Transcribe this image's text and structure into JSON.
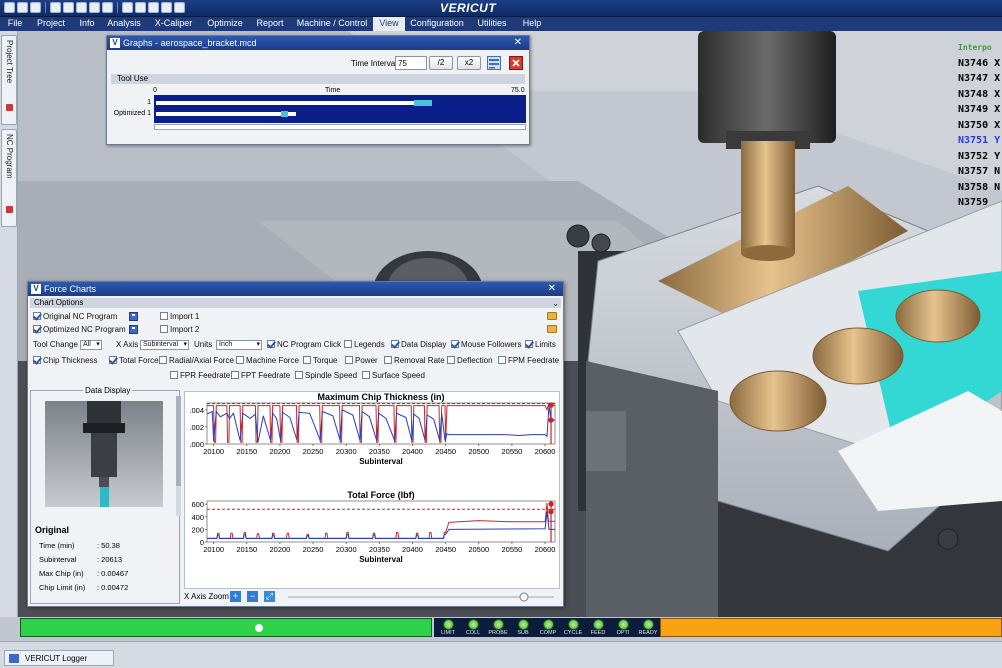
{
  "app": {
    "brand": "VERICUT"
  },
  "menu": [
    "File",
    "Project",
    "Info",
    "Analysis",
    "X-Caliper",
    "Optimize",
    "Report",
    "Machine / Control",
    "View",
    "Configuration",
    "Utilities",
    "Help"
  ],
  "active_menu": "View",
  "left_dock": {
    "tab1": "Project Tree",
    "tab2": "NC Program"
  },
  "nc_program": {
    "header": "Interpo",
    "lines": [
      "N3746 X",
      "N3747 X",
      "N3748 X",
      "N3749 X",
      "N3750 X",
      "N3751 Y",
      "N3752 Y",
      "N3757 N",
      "N3758 N",
      "N3759"
    ],
    "current_index": 5
  },
  "graphs_window": {
    "title": "Graphs - aerospace_bracket.mcd",
    "time_interval_label": "Time Interval",
    "time_interval_value": "75",
    "btn_half": "/2",
    "btn_double": "x2",
    "section": "Tool Use",
    "axis_start": "0",
    "axis_label": "Time",
    "axis_end": "75.0",
    "rows": [
      {
        "label": "1",
        "fill": 0.74,
        "marker_start": 0.7,
        "marker_width": 0.05
      },
      {
        "label": "Optimized 1",
        "fill": 0.38,
        "marker_start": 0.34,
        "marker_width": 0.02
      }
    ]
  },
  "force_window": {
    "title": "Force Charts",
    "chart_options_label": "Chart Options",
    "row1": {
      "original": "Original NC Program",
      "optimized": "Optimized NC Program",
      "import1": "Import 1",
      "import2": "Import 2"
    },
    "row3": {
      "tool_change_label": "Tool Change",
      "tool_change_value": "All",
      "x_axis_label": "X Axis",
      "x_axis_value": "Subinterval",
      "units_label": "Units",
      "units_value": "Inch",
      "nc_program_click": "NC Program Click",
      "legends": "Legends",
      "data_display": "Data Display",
      "mouse_followers": "Mouse Followers",
      "limits": "Limits"
    },
    "row4": [
      "Chip Thickness",
      "Total Force",
      "Radial/Axial Force",
      "Machine Force",
      "Torque",
      "Power",
      "Removal Rate",
      "Deflection",
      "FPM Feedrate"
    ],
    "row4_checked": [
      true,
      true,
      false,
      false,
      false,
      false,
      false,
      false,
      false
    ],
    "row5": [
      "FPR Feedrate",
      "FPT Feedrate",
      "Spindle Speed",
      "Surface Speed"
    ],
    "data_display": {
      "label": "Data Display",
      "section_title": "Original",
      "rows": [
        {
          "label": "Time (min)",
          "value": ": 50.38"
        },
        {
          "label": "Subinterval",
          "value": ": 20613"
        },
        {
          "label": "Max Chip (in)",
          "value": ": 0.00467"
        },
        {
          "label": "Chip Limit (in)",
          "value": ": 0.00472"
        }
      ]
    },
    "x_axis_zoom_label": "X Axis Zoom"
  },
  "chart_data": [
    {
      "type": "line",
      "title": "Maximum Chip Thickness (in)",
      "xlabel": "Subinterval",
      "ylabel": "",
      "xlim": [
        20090,
        20615
      ],
      "ylim": [
        0,
        0.0048
      ],
      "x_ticks": [
        20100,
        20150,
        20200,
        20250,
        20300,
        20350,
        20400,
        20450,
        20500,
        20550,
        20600
      ],
      "y_ticks": [
        ".004",
        ".002",
        ".000"
      ],
      "y_tick_values": [
        0.004,
        0.002,
        0.0
      ],
      "limit": 0.00472,
      "series": [
        {
          "color": "#c62828",
          "x": [
            20090,
            20100,
            20101,
            20103,
            20104,
            20120,
            20121,
            20123,
            20124,
            20140,
            20141,
            20143,
            20144,
            20163,
            20164,
            20166,
            20167,
            20185,
            20186,
            20188,
            20189,
            20200,
            20201,
            20203,
            20204,
            20225,
            20226,
            20228,
            20229,
            20260,
            20261,
            20263,
            20264,
            20290,
            20291,
            20293,
            20294,
            20320,
            20321,
            20323,
            20324,
            20345,
            20346,
            20348,
            20349,
            20372,
            20373,
            20375,
            20376,
            20398,
            20399,
            20401,
            20402,
            20418,
            20419,
            20421,
            20422,
            20440,
            20441,
            20443,
            20444,
            20449,
            20450,
            20452,
            20455,
            20600,
            20603,
            20605,
            20609,
            20612,
            20615
          ],
          "y": [
            0.0045,
            0.0045,
            0.0002,
            0.0002,
            0.0045,
            0.0045,
            0.0002,
            0.0002,
            0.0045,
            0.0045,
            0.0002,
            0.0002,
            0.0045,
            0.0045,
            0.0002,
            0.0002,
            0.0045,
            0.0045,
            0.0002,
            0.0002,
            0.0045,
            0.0045,
            0.0002,
            0.0002,
            0.0045,
            0.0045,
            0.0002,
            0.0002,
            0.0045,
            0.0045,
            0.0002,
            0.0002,
            0.0045,
            0.0045,
            0.0002,
            0.0002,
            0.0045,
            0.0045,
            0.0002,
            0.0002,
            0.0045,
            0.0045,
            0.0002,
            0.0002,
            0.0045,
            0.0045,
            0.0002,
            0.0002,
            0.0045,
            0.0045,
            0.0002,
            0.0002,
            0.0045,
            0.0045,
            0.0002,
            0.0002,
            0.0045,
            0.0045,
            0.0002,
            0.0002,
            0.0045,
            0.0045,
            0.0002,
            0.0045,
            0.0045,
            0.0045,
            0.004,
            0.0046,
            0.0046,
            0.0045,
            0.0045
          ]
        },
        {
          "color": "#2a3cb8",
          "x": [
            20090,
            20098,
            20100,
            20104,
            20110,
            20120,
            20124,
            20130,
            20140,
            20144,
            20155,
            20163,
            20167,
            20175,
            20186,
            20189,
            20195,
            20201,
            20204,
            20215,
            20226,
            20229,
            20245,
            20261,
            20264,
            20280,
            20291,
            20294,
            20310,
            20321,
            20324,
            20335,
            20346,
            20349,
            20360,
            20373,
            20376,
            20390,
            20399,
            20402,
            20410,
            20419,
            20422,
            20432,
            20441,
            20444,
            20449,
            20452,
            20455,
            20540,
            20560,
            20580,
            20600,
            20603,
            20606,
            20609,
            20615
          ],
          "y": [
            0.0035,
            0.0038,
            0.0003,
            0.0038,
            0.0032,
            0.0036,
            0.003,
            0.0036,
            0.0004,
            0.0036,
            0.003,
            0.0035,
            0.0002,
            0.0033,
            0.0004,
            0.0036,
            0.003,
            0.0004,
            0.0037,
            0.0031,
            0.0004,
            0.0037,
            0.0036,
            0.0004,
            0.0038,
            0.0033,
            0.0004,
            0.004,
            0.0034,
            0.0004,
            0.0038,
            0.0032,
            0.0004,
            0.0036,
            0.003,
            0.0004,
            0.0036,
            0.0031,
            0.0004,
            0.0035,
            0.003,
            0.0004,
            0.0034,
            0.0029,
            0.0004,
            0.0036,
            0.0004,
            0.0012,
            0.0011,
            0.0011,
            0.001,
            0.0011,
            0.0011,
            0.0009,
            0.0045,
            0.0028,
            0.0028
          ]
        }
      ]
    },
    {
      "type": "line",
      "title": "Total Force (lbf)",
      "xlabel": "Subinterval",
      "ylabel": "",
      "xlim": [
        20090,
        20615
      ],
      "ylim": [
        0,
        650
      ],
      "x_ticks": [
        20100,
        20150,
        20200,
        20250,
        20300,
        20350,
        20400,
        20450,
        20500,
        20550,
        20600
      ],
      "y_ticks": [
        "600",
        "400",
        "200",
        "0"
      ],
      "y_tick_values": [
        600,
        400,
        200,
        0
      ],
      "limit": 520,
      "series": [
        {
          "color": "#c62828",
          "x": [
            20090,
            20105,
            20106,
            20108,
            20109,
            20125,
            20126,
            20128,
            20129,
            20145,
            20146,
            20148,
            20149,
            20165,
            20166,
            20168,
            20169,
            20188,
            20189,
            20191,
            20192,
            20210,
            20211,
            20213,
            20214,
            20240,
            20241,
            20243,
            20244,
            20268,
            20269,
            20271,
            20272,
            20300,
            20301,
            20303,
            20304,
            20340,
            20341,
            20343,
            20344,
            20375,
            20376,
            20378,
            20379,
            20405,
            20406,
            20408,
            20409,
            20425,
            20426,
            20428,
            20429,
            20447,
            20448,
            20450,
            20455,
            20500,
            20550,
            20600,
            20603,
            20605,
            20608,
            20615
          ],
          "y": [
            60,
            60,
            140,
            140,
            60,
            60,
            140,
            140,
            60,
            60,
            150,
            150,
            60,
            60,
            130,
            130,
            60,
            60,
            140,
            140,
            60,
            60,
            140,
            140,
            60,
            60,
            120,
            120,
            60,
            60,
            140,
            140,
            60,
            60,
            150,
            150,
            60,
            60,
            140,
            140,
            60,
            60,
            150,
            150,
            60,
            60,
            140,
            140,
            60,
            60,
            150,
            150,
            60,
            60,
            150,
            150,
            310,
            340,
            320,
            320,
            620,
            330,
            330,
            330
          ]
        },
        {
          "color": "#2a3cb8",
          "x": [
            20090,
            20105,
            20106,
            20108,
            20109,
            20145,
            20146,
            20148,
            20149,
            20188,
            20189,
            20191,
            20192,
            20240,
            20241,
            20243,
            20244,
            20300,
            20301,
            20303,
            20304,
            20340,
            20341,
            20343,
            20344,
            20405,
            20406,
            20408,
            20409,
            20447,
            20448,
            20450,
            20455,
            20600,
            20603,
            20606,
            20615
          ],
          "y": [
            55,
            55,
            110,
            110,
            55,
            55,
            115,
            115,
            55,
            55,
            110,
            110,
            55,
            55,
            100,
            100,
            55,
            55,
            115,
            115,
            55,
            55,
            110,
            110,
            55,
            55,
            110,
            110,
            55,
            55,
            120,
            120,
            200,
            210,
            480,
            200,
            200
          ]
        }
      ]
    }
  ],
  "status": {
    "progress": 0.58,
    "lights": [
      "LIMIT",
      "COLL",
      "PROBE",
      "SUB",
      "COMP",
      "CYCLE",
      "FEED",
      "OPTI",
      "READY"
    ]
  },
  "logger": {
    "label": "VERICUT Logger"
  }
}
